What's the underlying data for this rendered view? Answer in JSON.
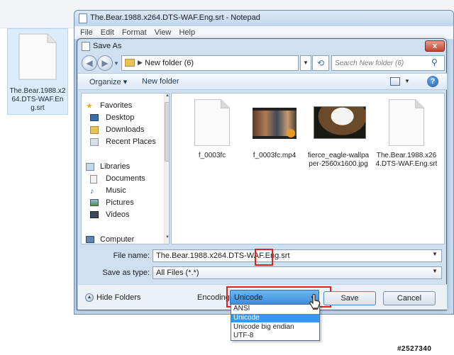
{
  "desktop": {
    "file_label": "The.Bear.1988.x264.DTS-WAF.Eng.srt"
  },
  "notepad": {
    "title": "The.Bear.1988.x264.DTS-WAF.Eng.srt - Notepad",
    "menu": [
      "File",
      "Edit",
      "Format",
      "View",
      "Help"
    ]
  },
  "dialog": {
    "title": "Save As",
    "close_symbol": "x",
    "address": {
      "path": "New folder (6)",
      "search_placeholder": "Search New folder (6)"
    },
    "toolbar": {
      "organize": "Organize",
      "new_folder": "New folder",
      "help_symbol": "?"
    },
    "nav": {
      "items": [
        {
          "label": "Favorites",
          "icon": "star-icon",
          "kind": "group"
        },
        {
          "label": "Desktop",
          "icon": "desktop-icon",
          "kind": "sub"
        },
        {
          "label": "Downloads",
          "icon": "downloads-icon",
          "kind": "sub"
        },
        {
          "label": "Recent Places",
          "icon": "recent-places-icon",
          "kind": "sub"
        },
        {
          "label": "Libraries",
          "icon": "libraries-icon",
          "kind": "group"
        },
        {
          "label": "Documents",
          "icon": "documents-icon",
          "kind": "sub"
        },
        {
          "label": "Music",
          "icon": "music-icon",
          "kind": "sub"
        },
        {
          "label": "Pictures",
          "icon": "pictures-icon",
          "kind": "sub"
        },
        {
          "label": "Videos",
          "icon": "videos-icon",
          "kind": "sub"
        },
        {
          "label": "Computer",
          "icon": "computer-icon",
          "kind": "group"
        }
      ]
    },
    "files": [
      {
        "name": "f_0003fc",
        "icon": "blank-file-icon"
      },
      {
        "name": "f_0003fc.mp4",
        "icon": "video-thumbnail"
      },
      {
        "name": "fierce_eagle-wallpaper-2560x1600.jpg",
        "icon": "eagle-image-thumbnail"
      },
      {
        "name": "The.Bear.1988.x264.DTS-WAF.Eng.srt",
        "icon": "blank-file-icon"
      }
    ],
    "file_name": {
      "label": "File name:",
      "value": "The.Bear.1988.x264.DTS-WAF.Eng.srt"
    },
    "save_as_type": {
      "label": "Save as type:",
      "value": "All Files  (*.*)"
    },
    "bottom": {
      "hide_folders": "Hide Folders",
      "encoding_label": "Encoding:",
      "encoding_value": "Unicode",
      "save": "Save",
      "cancel": "Cancel"
    },
    "encoding_options": [
      "ANSI",
      "Unicode",
      "Unicode big endian",
      "UTF-8"
    ],
    "encoding_selected_index": 1
  },
  "watermark": "#2527340",
  "colors": {
    "highlight_red": "#e21f1f",
    "selection_blue": "#3399ff"
  }
}
